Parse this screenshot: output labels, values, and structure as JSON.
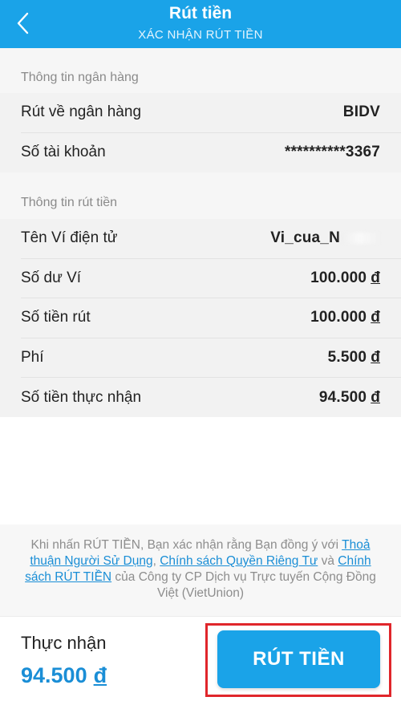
{
  "header": {
    "title": "Rút tiền",
    "subtitle": "XÁC NHẬN RÚT TIỀN",
    "back_icon": "chevron-left-icon"
  },
  "bank_info": {
    "section_title": "Thông tin ngân hàng",
    "rows": [
      {
        "label": "Rút về ngân hàng",
        "value": "BIDV"
      },
      {
        "label": "Số tài khoản",
        "value": "**********3367"
      }
    ]
  },
  "withdraw_info": {
    "section_title": "Thông tin rút tiền",
    "rows": [
      {
        "label": "Tên Ví điện tử",
        "value": "Vi_cua_N"
      },
      {
        "label": "Số dư Ví",
        "value": "100.000",
        "currency": "đ"
      },
      {
        "label": "Số tiền rút",
        "value": "100.000",
        "currency": "đ"
      },
      {
        "label": "Phí",
        "value": "5.500",
        "currency": "đ"
      },
      {
        "label": "Số tiền thực nhận",
        "value": "94.500",
        "currency": "đ"
      }
    ]
  },
  "terms": {
    "prefix": "Khi nhấn RÚT TIỀN, Bạn xác nhận rằng Bạn đồng ý với ",
    "link1": "Thoả thuận Người Sử Dụng",
    "sep1": ", ",
    "link2": "Chính sách Quyền Riêng Tư",
    "sep2": " và ",
    "link3": "Chính sách RÚT TIỀN",
    "suffix": " của Công ty CP Dịch vụ Trực tuyến Cộng Đồng Việt (VietUnion)"
  },
  "footer": {
    "receive_label": "Thực nhận",
    "receive_amount": "94.500",
    "receive_currency": "đ",
    "button_label": "RÚT TIỀN"
  },
  "colors": {
    "primary": "#1aa3e8",
    "link": "#1a8ed6",
    "highlight": "#e0262b"
  }
}
